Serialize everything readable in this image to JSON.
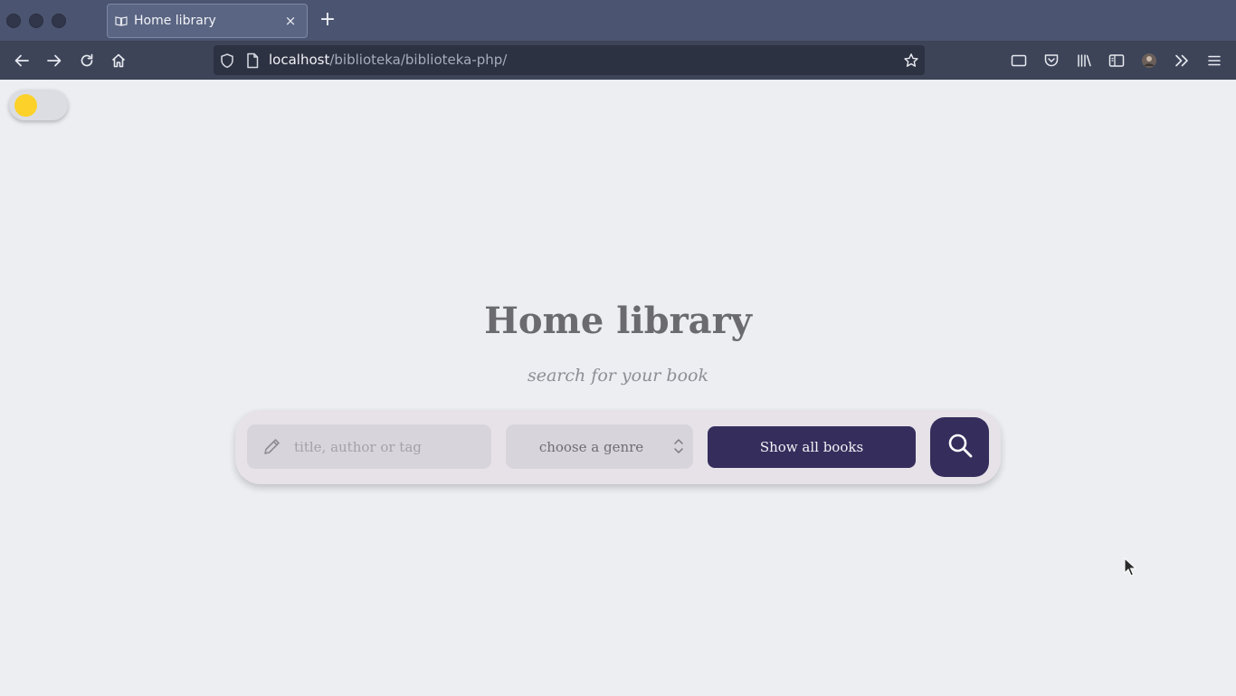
{
  "browser": {
    "tab": {
      "title": "Home library",
      "close_glyph": "×",
      "icon": "book-open-icon"
    },
    "new_tab_glyph": "+",
    "url": {
      "host": "localhost",
      "path": "/biblioteka/biblioteka-php/"
    },
    "nav_icons": [
      "back-arrow-icon",
      "forward-arrow-icon",
      "reload-icon",
      "home-icon"
    ],
    "toolbar_icons": [
      "container-icon",
      "pocket-icon",
      "library-icon",
      "sidebar-icon",
      "profile-avatar",
      "overflow-icon",
      "menu-icon"
    ]
  },
  "page": {
    "title": "Home library",
    "subtitle": "search for your book",
    "search": {
      "placeholder": "title, author or tag",
      "value": ""
    },
    "genre": {
      "selected": "choose a genre"
    },
    "show_all_label": "Show all books",
    "theme_toggle": {
      "state": "light"
    }
  },
  "colors": {
    "page_background": "#eceef2",
    "accent": "#352e5c",
    "toggle_knob": "#fcd12a",
    "tabbar": "#4b5470",
    "navbar": "#3d4458"
  }
}
